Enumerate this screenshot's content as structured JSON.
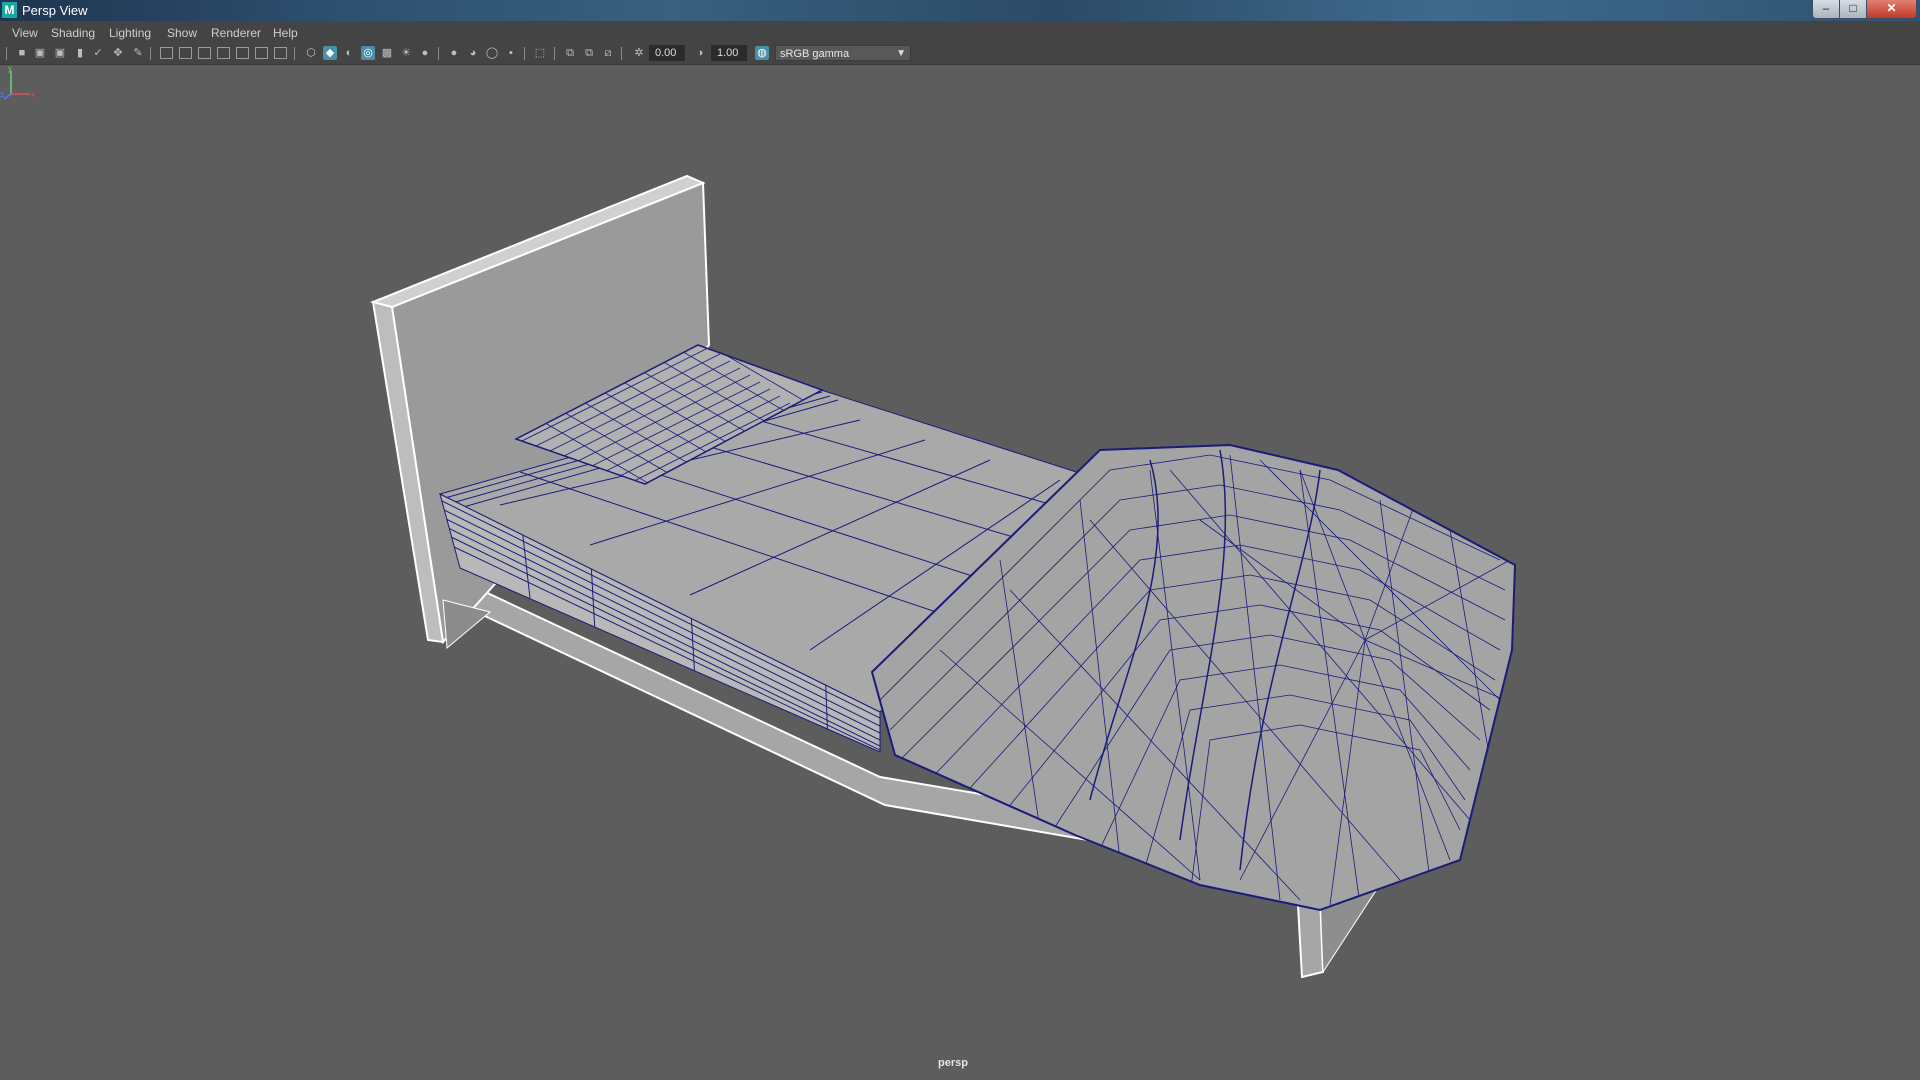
{
  "window": {
    "title": "Persp View",
    "app_icon_letter": "M",
    "minimize_glyph": "–",
    "maximize_glyph": "□",
    "close_glyph": "✕"
  },
  "menu": {
    "items": [
      "View",
      "Shading",
      "Lighting",
      "Show",
      "Renderer",
      "Help"
    ]
  },
  "toolbar": {
    "exposure_value": "0.00",
    "gamma_value": "1.00",
    "color_space": "sRGB gamma",
    "icons": [
      "camera-select-icon",
      "camera-lock-icon",
      "bookmark-icon",
      "image-plane-icon",
      "grid-icon",
      "film-gate-icon",
      "resolution-gate-icon",
      "gate-mask-icon",
      "field-chart-icon",
      "safe-action-icon",
      "safe-title-icon",
      "wireframe-icon",
      "smooth-shade-icon",
      "default-material-icon",
      "wireframe-on-shaded-icon",
      "xray-icon",
      "use-all-lights-icon",
      "shadows-icon",
      "screen-space-ao-icon",
      "motion-blur-icon",
      "anti-aliasing-icon",
      "depth-of-field-icon",
      "isolate-select-icon",
      "xray-joints-icon",
      "xray-active-icon",
      "exposure-icon",
      "gamma-icon",
      "color-management-icon"
    ]
  },
  "viewport": {
    "camera": "persp",
    "axis": {
      "y": "y",
      "x": "x",
      "z": "z"
    },
    "colors": {
      "background": "#5d5d5d",
      "surface": "#9e9e9e",
      "wireframe": "#1b1b7a"
    }
  }
}
